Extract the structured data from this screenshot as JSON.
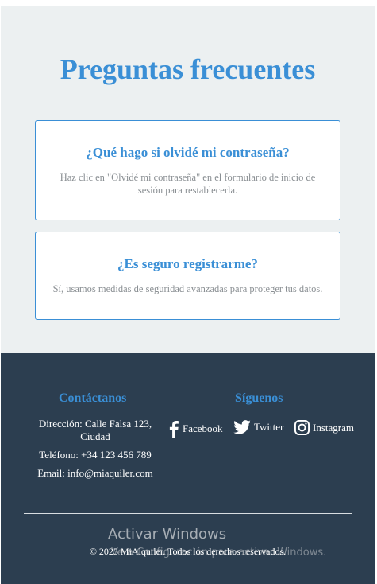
{
  "faq": {
    "title": "Preguntas frecuentes",
    "items": [
      {
        "question": "¿Qué hago si olvidé mi contraseña?",
        "answer": "Haz clic en \"Olvidé mi contraseña\" en el formulario de inicio de sesión para restablecerla."
      },
      {
        "question": "¿Es seguro registrarme?",
        "answer": "Sí, usamos medidas de seguridad avanzadas para proteger tus datos."
      }
    ]
  },
  "footer": {
    "contact_heading": "Contáctanos",
    "address": "Dirección: Calle Falsa 123, Ciudad",
    "phone": "Teléfono: +34 123 456 789",
    "email": "Email: info@miaquiler.com",
    "follow_heading": "Síguenos",
    "social": [
      {
        "label": "Facebook",
        "icon": "facebook-icon"
      },
      {
        "label": "Twitter",
        "icon": "twitter-icon"
      },
      {
        "label": "Instagram",
        "icon": "instagram-icon"
      }
    ],
    "copyright": "© 2025 MiAlquiler. Todos los derechos reservados."
  },
  "windows_watermark": {
    "title": "Activar Windows",
    "subtitle": "Ve a Configuración para activar Windows."
  },
  "colors": {
    "accent": "#3a8fd6",
    "page_background": "#ecf0f1",
    "footer_background": "#2c3e50",
    "muted_text": "#8a8f93"
  }
}
